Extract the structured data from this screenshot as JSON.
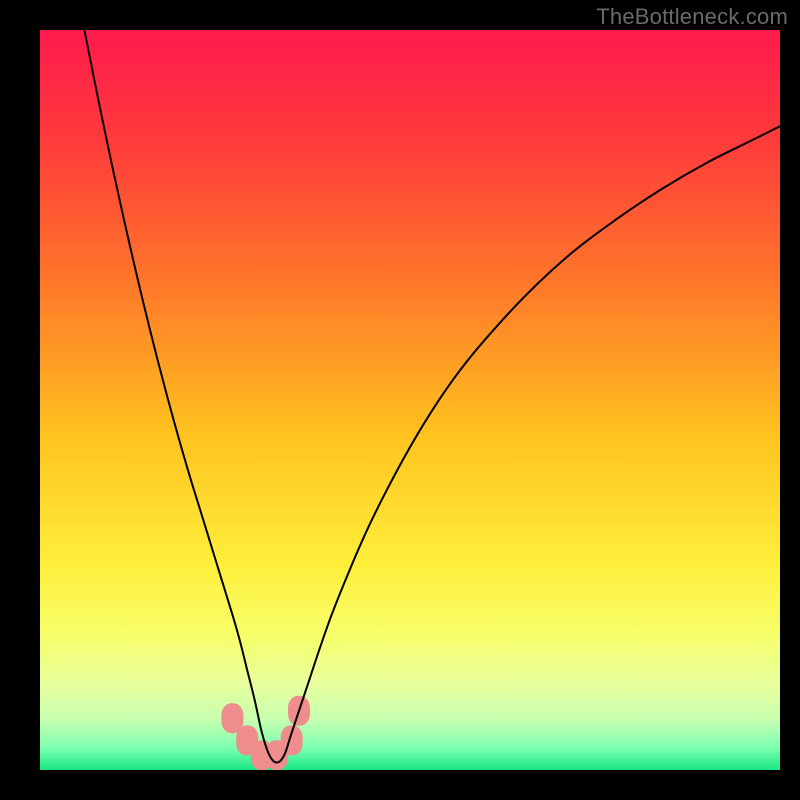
{
  "watermark": "TheBottleneck.com",
  "chart_data": {
    "type": "line",
    "title": "",
    "xlabel": "",
    "ylabel": "",
    "xlim": [
      0,
      100
    ],
    "ylim": [
      0,
      100
    ],
    "grid": false,
    "legend": false,
    "background_gradient_stops": [
      {
        "pos": 0.0,
        "color": "#ff1a4d"
      },
      {
        "pos": 0.15,
        "color": "#ff3b3b"
      },
      {
        "pos": 0.35,
        "color": "#ff7a29"
      },
      {
        "pos": 0.55,
        "color": "#ffc31f"
      },
      {
        "pos": 0.72,
        "color": "#ffee3a"
      },
      {
        "pos": 0.82,
        "color": "#f6ff6b"
      },
      {
        "pos": 0.88,
        "color": "#e9ff9a"
      },
      {
        "pos": 0.93,
        "color": "#c9ffb0"
      },
      {
        "pos": 0.97,
        "color": "#7dffb0"
      },
      {
        "pos": 1.0,
        "color": "#17e884"
      }
    ],
    "series": [
      {
        "name": "bottleneck-curve",
        "stroke": "#000000",
        "stroke_width": 2,
        "x": [
          6,
          8,
          10,
          12,
          14,
          16,
          18,
          20,
          22,
          24,
          26,
          27,
          28,
          29,
          30,
          31,
          32,
          33,
          34,
          36,
          38,
          40,
          44,
          48,
          52,
          56,
          60,
          66,
          72,
          78,
          84,
          90,
          96,
          100
        ],
        "y": [
          100,
          90,
          80.5,
          71.5,
          63,
          55,
          47.5,
          40.5,
          34,
          27.5,
          21,
          17.5,
          13.5,
          9.5,
          5,
          2,
          1,
          2,
          5,
          11,
          17,
          22.5,
          32,
          40,
          47,
          53,
          58,
          64.5,
          70,
          74.5,
          78.5,
          82,
          85,
          87
        ]
      }
    ],
    "markers": [
      {
        "name": "marker",
        "x": 26,
        "y": 7,
        "color": "#ef8d8d"
      },
      {
        "name": "marker",
        "x": 28,
        "y": 4,
        "color": "#ef8d8d"
      },
      {
        "name": "marker",
        "x": 30,
        "y": 2,
        "color": "#ef8d8d"
      },
      {
        "name": "marker",
        "x": 32,
        "y": 2,
        "color": "#ef8d8d"
      },
      {
        "name": "marker",
        "x": 34,
        "y": 4,
        "color": "#ef8d8d"
      },
      {
        "name": "marker",
        "x": 35,
        "y": 8,
        "color": "#ef8d8d"
      }
    ]
  }
}
